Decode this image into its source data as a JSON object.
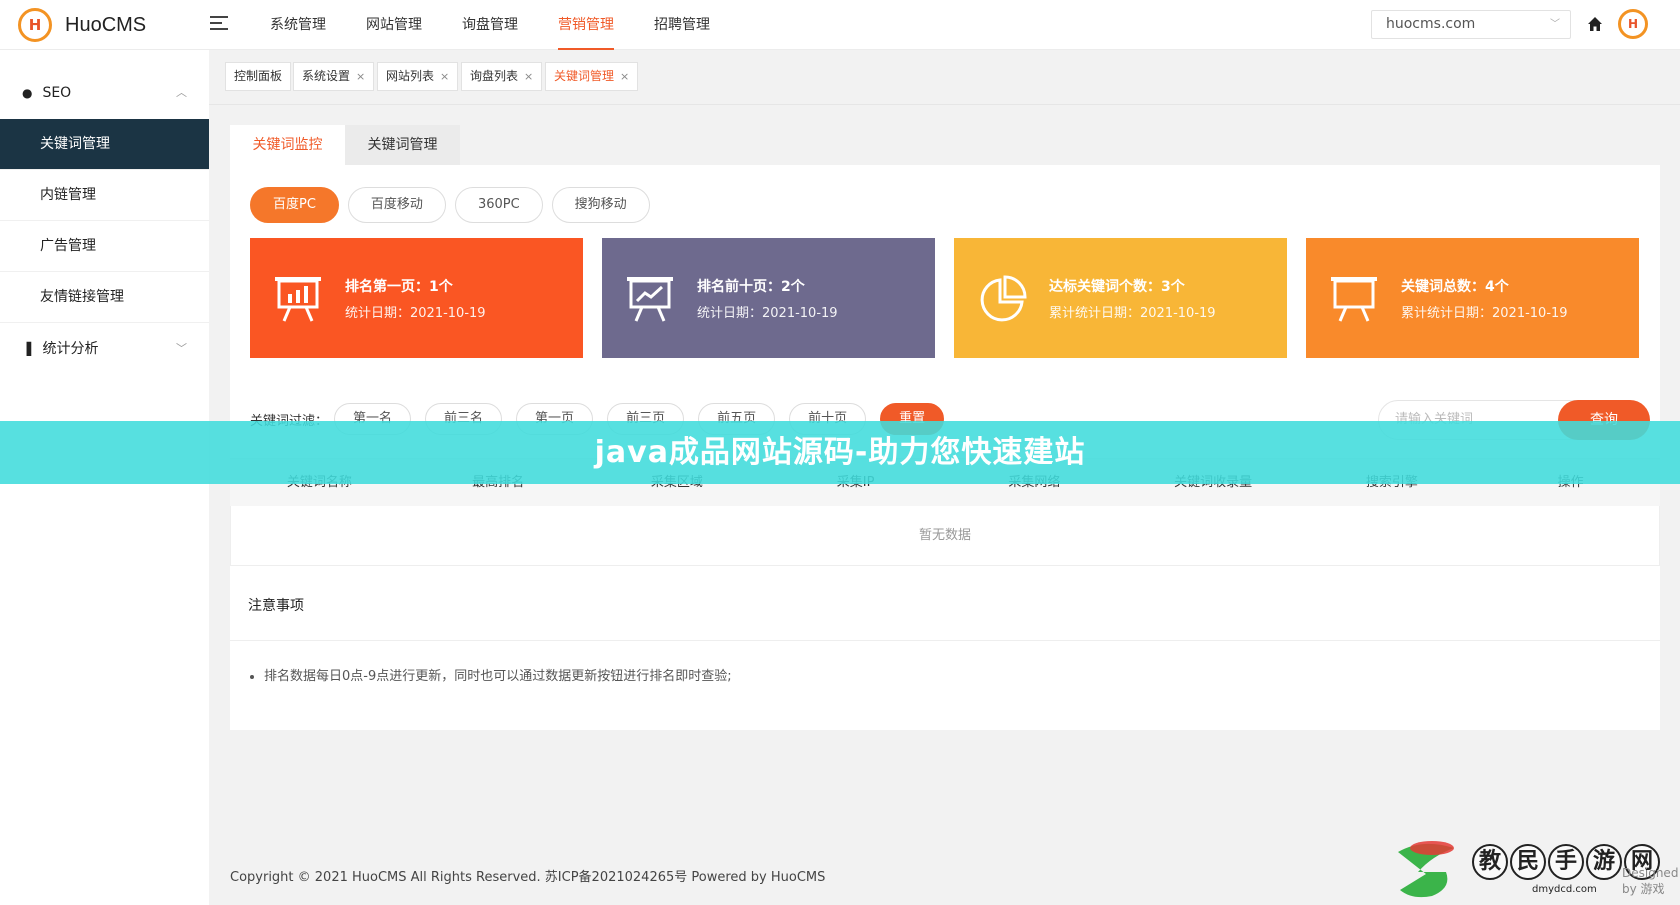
{
  "app": {
    "name": "HuoCMS",
    "logo_mark": "H"
  },
  "topnav": {
    "items": [
      {
        "label": "系统管理",
        "active": false
      },
      {
        "label": "网站管理",
        "active": false
      },
      {
        "label": "询盘管理",
        "active": false
      },
      {
        "label": "营销管理",
        "active": true
      },
      {
        "label": "招聘管理",
        "active": false
      }
    ],
    "site_select": "huocms.com",
    "icons": [
      "menu-toggle-icon",
      "home-icon",
      "chevron-down-icon"
    ]
  },
  "sidebar": {
    "group1": {
      "label": "SEO",
      "icon": "search-icon"
    },
    "items": [
      {
        "label": "关键词管理",
        "active": true
      },
      {
        "label": "内链管理",
        "active": false
      },
      {
        "label": "广告管理",
        "active": false
      },
      {
        "label": "友情链接管理",
        "active": false
      }
    ],
    "group2": {
      "label": "统计分析",
      "icon": "bar-chart-icon"
    }
  },
  "tabstrip": {
    "tabs": [
      {
        "label": "控制面板",
        "closable": false,
        "active": false
      },
      {
        "label": "系统设置",
        "closable": true,
        "active": false
      },
      {
        "label": "网站列表",
        "closable": true,
        "active": false
      },
      {
        "label": "询盘列表",
        "closable": true,
        "active": false
      },
      {
        "label": "关键词管理",
        "closable": true,
        "active": true
      }
    ],
    "close_glyph": "×"
  },
  "subtabs": [
    {
      "label": "关键词监控",
      "active": true
    },
    {
      "label": "关键词管理",
      "active": false
    }
  ],
  "engines": [
    {
      "label": "百度PC",
      "active": true
    },
    {
      "label": "百度移动",
      "active": false
    },
    {
      "label": "360PC",
      "active": false
    },
    {
      "label": "搜狗移动",
      "active": false
    }
  ],
  "stat_cards": [
    {
      "title": "排名第一页：1个",
      "date_label": "统计日期：2021-10-19",
      "color": "#fa5623",
      "icon": "presentation-bar-icon"
    },
    {
      "title": "排名前十页：2个",
      "date_label": "统计日期：2021-10-19",
      "color": "#6e6a8e",
      "icon": "presentation-line-icon"
    },
    {
      "title": "达标关键词个数：3个",
      "date_label": "累计统计日期：2021-10-19",
      "color": "#f8b637",
      "icon": "pie-chart-icon"
    },
    {
      "title": "关键词总数：4个",
      "date_label": "累计统计日期：2021-10-19",
      "color": "#f98a2b",
      "icon": "board-icon"
    }
  ],
  "filter": {
    "label": "关键词过滤：",
    "options": [
      "第一名",
      "前三名",
      "第一页",
      "前三页",
      "前五页",
      "前十页"
    ],
    "reset_label": "重置",
    "search_placeholder": "请输入关键词",
    "search_button": "查询"
  },
  "table": {
    "columns": [
      "关键词名称",
      "最高排名",
      "采集区域",
      "采集IP",
      "采集网络",
      "关键词收录量",
      "搜索引擎",
      "操作"
    ],
    "empty_text": "暂无数据"
  },
  "notes": {
    "title": "注意事项",
    "items": [
      "排名数据每日0点-9点进行更新，同时也可以通过数据更新按钮进行排名即时查验;"
    ]
  },
  "footer": {
    "text": "Copyright © 2021 HuoCMS All Rights Reserved. 苏ICP备2021024265号 Powered by HuoCMS"
  },
  "banner": {
    "text": "java成品网站源码-助力您快速建站"
  },
  "watermark": {
    "chars": [
      "教",
      "民",
      "手",
      "游",
      "网"
    ],
    "domain": "dmydcd.com",
    "design_credit": "Designed by 游戏"
  }
}
